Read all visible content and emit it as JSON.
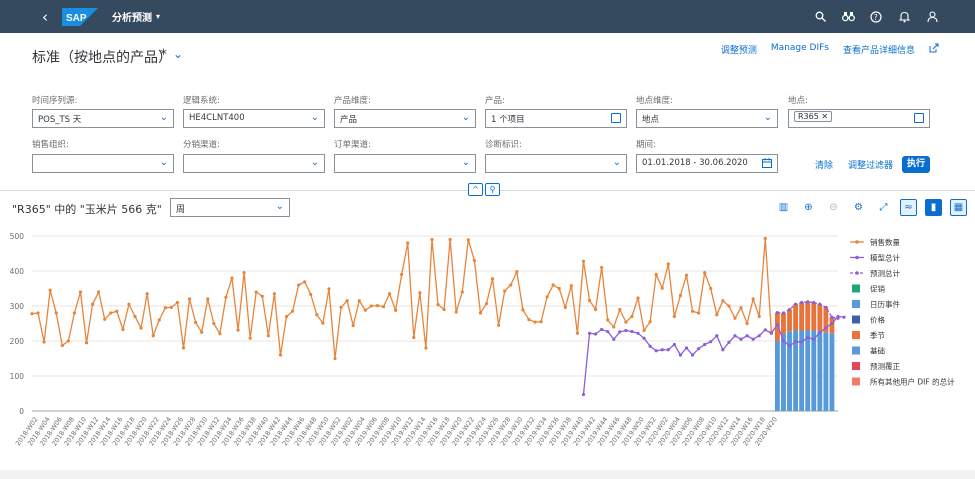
{
  "shell": {
    "back_icon": "back-icon",
    "logo_text": "SAP",
    "app_title": "分析预测",
    "app_caret": "▾",
    "icons": [
      "search-icon",
      "binoculars-icon",
      "help-icon",
      "notification-icon",
      "user-icon"
    ]
  },
  "header": {
    "title": "标准（按地点的产品）",
    "star": "*",
    "links": [
      "调整预测",
      "Manage DIFs",
      "查看产品详细信息"
    ]
  },
  "filters": {
    "series_source": {
      "label": "时间序列源:",
      "value": "POS_TS 天"
    },
    "logical_system": {
      "label": "逻辑系统:",
      "value": "HE4CLNT400"
    },
    "product_dimension": {
      "label": "产品维度:",
      "value": "产品"
    },
    "product": {
      "label": "产品:",
      "value": "1 个项目"
    },
    "location_dimension": {
      "label": "地点维度:",
      "value": "地点"
    },
    "location": {
      "label": "地点:",
      "token": "R365"
    },
    "sales_org": {
      "label": "销售组织:",
      "value": ""
    },
    "distribution_channel": {
      "label": "分销渠道:",
      "value": ""
    },
    "order_channel": {
      "label": "订单渠道:",
      "value": ""
    },
    "diagnosis": {
      "label": "诊断标识:",
      "value": ""
    },
    "period": {
      "label": "期间:",
      "value": "01.01.2018 - 30.06.2020"
    },
    "clear_label": "清除",
    "adapt_label": "调整过滤器",
    "go_label": "执行"
  },
  "chart_header": {
    "title": "\"R365\" 中的 \"玉米片 566 克\"",
    "granularity": "周"
  },
  "colors": {
    "shell": "#354a5f",
    "sales": "#e8853a",
    "model": "#8b5fd8",
    "forecast": "#8b5fd8",
    "baseline": "#5899da",
    "season": "#e8743b",
    "accent": "#0a6ed1"
  },
  "chart_data": {
    "type": "line",
    "ylim": [
      0,
      500
    ],
    "yticks": [
      0,
      100,
      200,
      300,
      400,
      500
    ],
    "grid": true,
    "legend_position": "right",
    "legend": [
      "销售数量",
      "模型总计",
      "预测总计",
      "促销",
      "日历事件",
      "价格",
      "季节",
      "基础",
      "预测覆正",
      "所有其他用户 DIF 的总计"
    ],
    "legend_colors": [
      "#e8853a",
      "#8b5fd8",
      "#8b5fd8",
      "#19a979",
      "#5899da",
      "#3f5ea8",
      "#e8743b",
      "#5899da",
      "#e2475c",
      "#f07c6b"
    ],
    "x_labels": [
      "2018-W02",
      "2018-W04",
      "2018-W06",
      "2018-W08",
      "2018-W10",
      "2018-W12",
      "2018-W14",
      "2018-W16",
      "2018-W18",
      "2018-W20",
      "2018-W22",
      "2018-W24",
      "2018-W26",
      "2018-W28",
      "2018-W30",
      "2018-W32",
      "2018-W34",
      "2018-W36",
      "2018-W38",
      "2018-W40",
      "2018-W42",
      "2018-W44",
      "2018-W46",
      "2018-W48",
      "2018-W50",
      "2018-W52",
      "2019-W02",
      "2019-W04",
      "2019-W06",
      "2019-W08",
      "2019-W10",
      "2019-W12",
      "2019-W14",
      "2019-W16",
      "2019-W18",
      "2019-W20",
      "2019-W22",
      "2019-W24",
      "2019-W26",
      "2019-W28",
      "2019-W30",
      "2019-W32",
      "2019-W34",
      "2019-W36",
      "2019-W38",
      "2019-W40",
      "2019-W42",
      "2019-W44",
      "2019-W46",
      "2019-W48",
      "2019-W50",
      "2019-W52",
      "2020-W02",
      "2020-W04",
      "2020-W06",
      "2020-W08",
      "2020-W10",
      "2020-W12",
      "2020-W14",
      "2020-W16",
      "2020-W18",
      "2020-W20"
    ],
    "series": [
      {
        "name": "销售数量",
        "start_week": 1,
        "values": [
          278,
          280,
          197,
          345,
          280,
          187,
          200,
          280,
          340,
          195,
          305,
          340,
          262,
          280,
          285,
          233,
          305,
          270,
          237,
          335,
          215,
          260,
          295,
          296,
          310,
          180,
          320,
          253,
          225,
          320,
          250,
          221,
          325,
          380,
          231,
          395,
          208,
          340,
          328,
          215,
          335,
          160,
          270,
          285,
          360,
          369,
          333,
          275,
          251,
          349,
          150,
          296,
          315,
          244,
          315,
          288,
          300,
          301,
          298,
          335,
          288,
          390,
          480,
          210,
          338,
          180,
          490,
          304,
          290,
          490,
          283,
          340,
          489,
          430,
          280,
          307,
          378,
          245,
          343,
          360,
          398,
          289,
          261,
          254,
          255,
          326,
          360,
          350,
          296,
          358,
          222,
          428,
          316,
          290,
          410,
          260,
          240,
          290,
          254,
          270,
          323,
          230,
          255,
          390,
          351,
          420,
          270,
          330,
          388,
          285,
          280,
          395,
          350,
          275,
          315,
          300,
          265,
          295,
          250,
          320,
          270,
          493,
          226
        ]
      },
      {
        "name": "模型总计",
        "start_week": 92,
        "values": [
          47,
          222,
          220,
          233,
          227,
          205,
          226,
          230,
          227,
          222,
          208,
          185,
          172,
          175,
          175,
          190,
          160,
          180,
          160,
          178,
          190,
          198,
          215,
          175,
          196,
          215,
          205,
          215,
          205,
          215,
          232,
          222,
          247,
          200,
          186,
          198,
          197,
          210,
          205,
          224,
          238,
          250,
          270,
          268
        ]
      },
      {
        "name": "预测总计",
        "start_week": 124,
        "values": [
          281,
          280,
          290,
          305,
          310,
          312,
          310,
          305,
          296,
          268,
          265
        ]
      },
      {
        "name": "基础",
        "type": "bar",
        "start_week": 124,
        "values": [
          200,
          220,
          228,
          230,
          230,
          230,
          230,
          228,
          225,
          222
        ]
      },
      {
        "name": "季节",
        "type": "bar",
        "start_week": 124,
        "values": [
          81,
          60,
          62,
          75,
          80,
          82,
          80,
          77,
          71,
          46
        ]
      }
    ]
  }
}
